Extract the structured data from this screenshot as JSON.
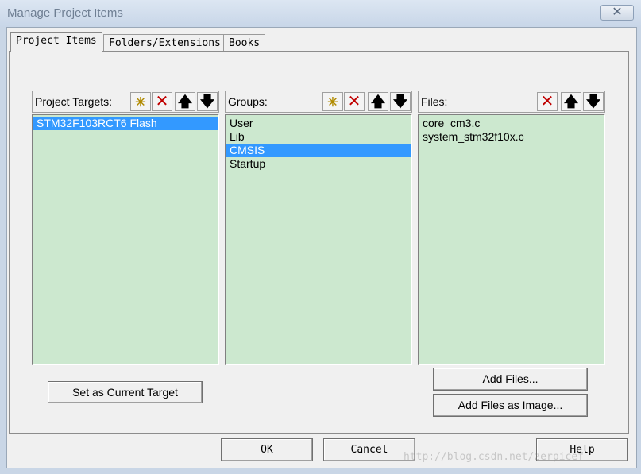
{
  "window": {
    "title": "Manage Project Items",
    "close_glyph": "✕"
  },
  "tabs": [
    {
      "label": "Project Items"
    },
    {
      "label": "Folders/Extensions"
    },
    {
      "label": "Books"
    }
  ],
  "targets": {
    "header": "Project Targets:",
    "items": [
      "STM32F103RCT6 Flash"
    ],
    "selected_index": 0
  },
  "groups": {
    "header": "Groups:",
    "items": [
      "User",
      "Lib",
      "CMSIS",
      "Startup"
    ],
    "selected_index": 2
  },
  "files": {
    "header": "Files:",
    "items": [
      "core_cm3.c",
      "system_stm32f10x.c"
    ]
  },
  "toolbar_icons": {
    "new": "new-item-icon",
    "delete": "delete-icon",
    "up": "move-up-icon",
    "down": "move-down-icon",
    "glyphs": {
      "new": "✳",
      "delete": "✕",
      "up": "🡅",
      "down": "🡇"
    }
  },
  "buttons": {
    "set_target": "Set as Current Target",
    "add_files": "Add Files...",
    "add_files_image": "Add Files as Image...",
    "ok": "OK",
    "cancel": "Cancel",
    "help": "Help"
  },
  "watermark": "http://blog.csdn.net/zerpicef",
  "colors": {
    "list_bg": "#cce8cf",
    "selection": "#3399ff"
  }
}
